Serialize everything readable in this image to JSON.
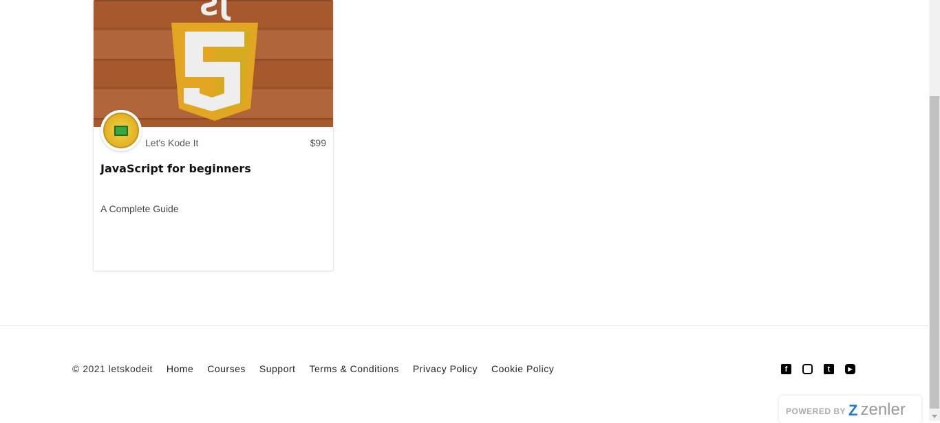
{
  "course": {
    "author": "Let's Kode It",
    "price": "$99",
    "title": "JavaScript for beginners",
    "subtitle": "A Complete Guide",
    "thumb_text": "JS"
  },
  "footer": {
    "copyright": "© 2021 letskodeit",
    "links": [
      "Home",
      "Courses",
      "Support",
      "Terms & Conditions",
      "Privacy Policy",
      "Cookie Policy"
    ],
    "social": [
      "facebook-icon",
      "instagram-icon",
      "twitter-icon",
      "youtube-icon"
    ]
  },
  "powered": {
    "label": "POWERED BY",
    "brand": "zenler"
  }
}
